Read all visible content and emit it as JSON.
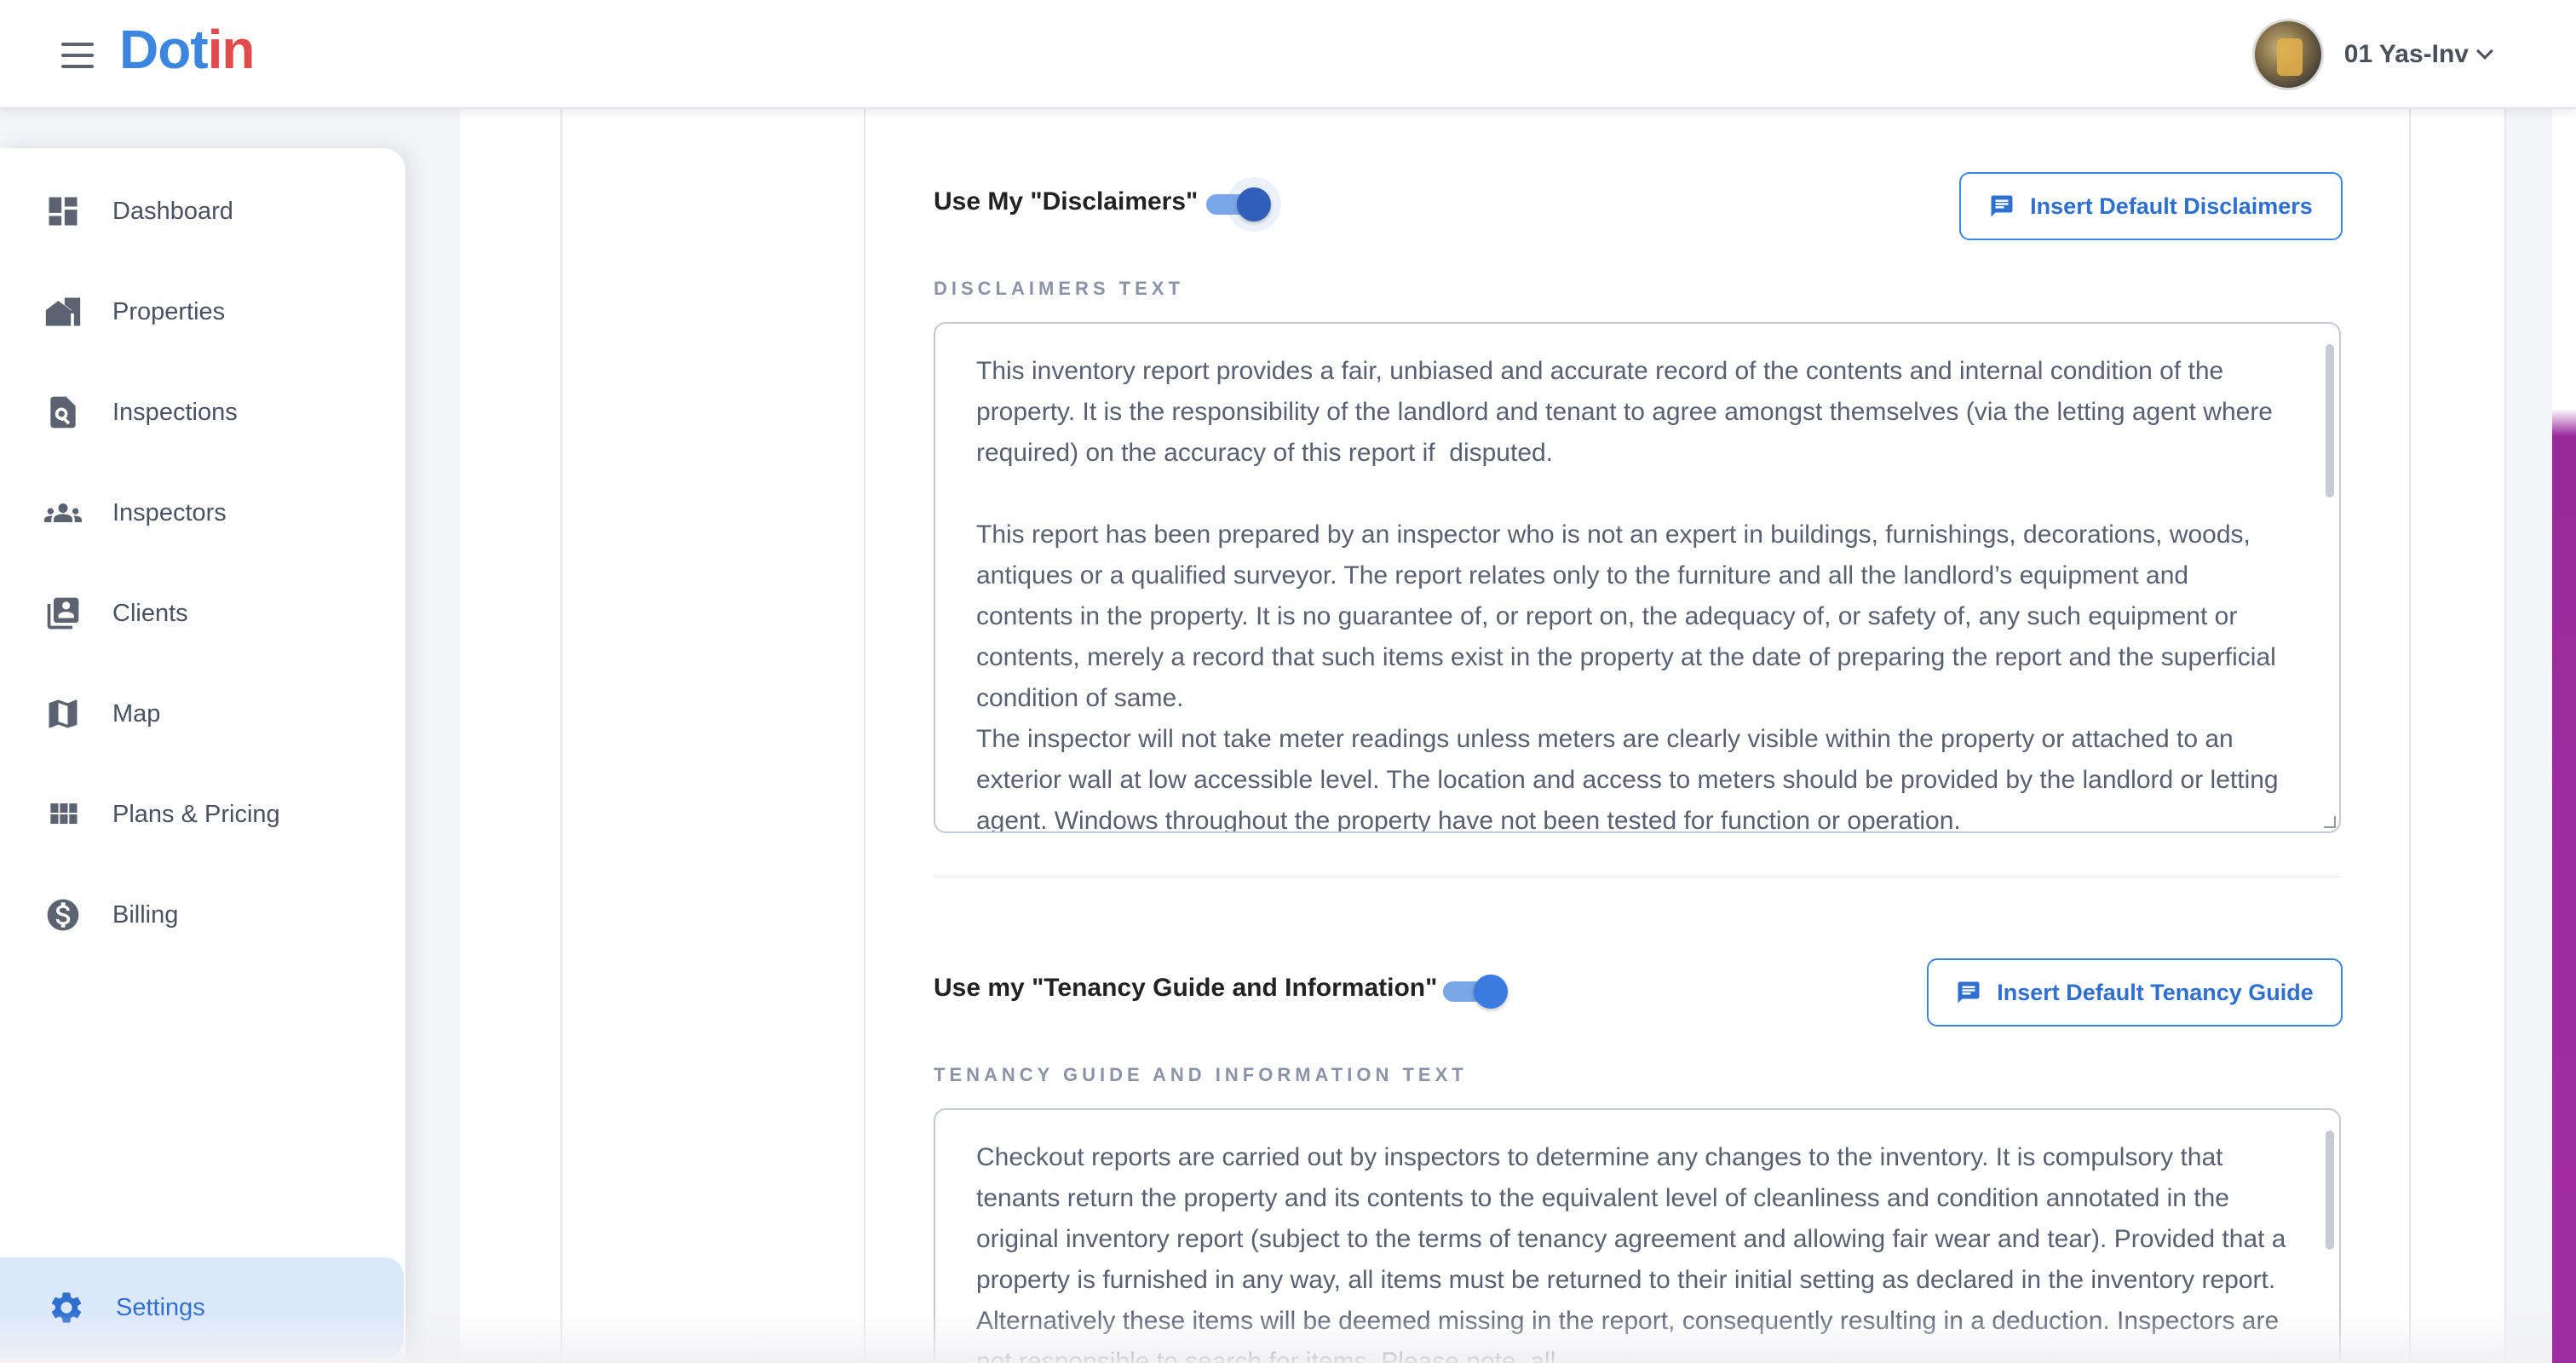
{
  "header": {
    "logo_part1": "Dot",
    "logo_part2": "in",
    "user_name": "01 Yas-Inv"
  },
  "sidebar": {
    "items": [
      {
        "label": "Dashboard",
        "icon": "dashboard-icon"
      },
      {
        "label": "Properties",
        "icon": "properties-icon"
      },
      {
        "label": "Inspections",
        "icon": "inspections-icon"
      },
      {
        "label": "Inspectors",
        "icon": "inspectors-icon"
      },
      {
        "label": "Clients",
        "icon": "clients-icon"
      },
      {
        "label": "Map",
        "icon": "map-icon"
      },
      {
        "label": "Plans & Pricing",
        "icon": "plans-icon"
      },
      {
        "label": "Billing",
        "icon": "billing-icon"
      }
    ],
    "settings": {
      "label": "Settings",
      "icon": "gear-icon"
    }
  },
  "disclaimers": {
    "toggle_label": "Use My \"Disclaimers\"",
    "toggle_on": true,
    "button_label": "Insert Default Disclaimers",
    "field_caption": "DISCLAIMERS TEXT",
    "text": "This inventory report provides a fair, unbiased and accurate record of the contents and internal condition of the property. It is the responsibility of the landlord and tenant to agree amongst themselves (via the letting agent where required) on the accuracy of this report if  disputed.\n\nThis report has been prepared by an inspector who is not an expert in buildings, furnishings, decorations, woods, antiques or a qualified surveyor. The report relates only to the furniture and all the landlord’s equipment and contents in the property. It is no guarantee of, or report on, the adequacy of, or safety of, any such equipment or contents, merely a record that such items exist in the property at the date of preparing the report and the superficial condition of same.\nThe inspector will not take meter readings unless meters are clearly visible within the property or attached to an exterior wall at low accessible level. The location and access to meters should be provided by the landlord or letting agent. Windows throughout the property have not been tested for function or operation."
  },
  "tenancy": {
    "toggle_label": "Use my \"Tenancy Guide and Information\"",
    "toggle_on": true,
    "button_label": "Insert Default Tenancy Guide",
    "field_caption": "TENANCY GUIDE AND INFORMATION TEXT",
    "text": "Checkout reports are carried out by inspectors to determine any changes to the inventory. It is compulsory that tenants return the property and its contents to the equivalent level of cleanliness and condition annotated in the original inventory report (subject to the terms of tenancy agreement and allowing fair wear and tear). Provided that a property is furnished in any way, all items must be returned to their initial setting as declared in the inventory report. Alternatively these items will be deemed missing in the report, consequently resulting in a deduction. Inspectors are not responsible to search for items. Please note, all"
  },
  "colors": {
    "accent": "#3d86de",
    "logo_red": "#e14b4b",
    "active_bg": "#dce9fb",
    "toggle_knob": "#2f5fb8"
  }
}
